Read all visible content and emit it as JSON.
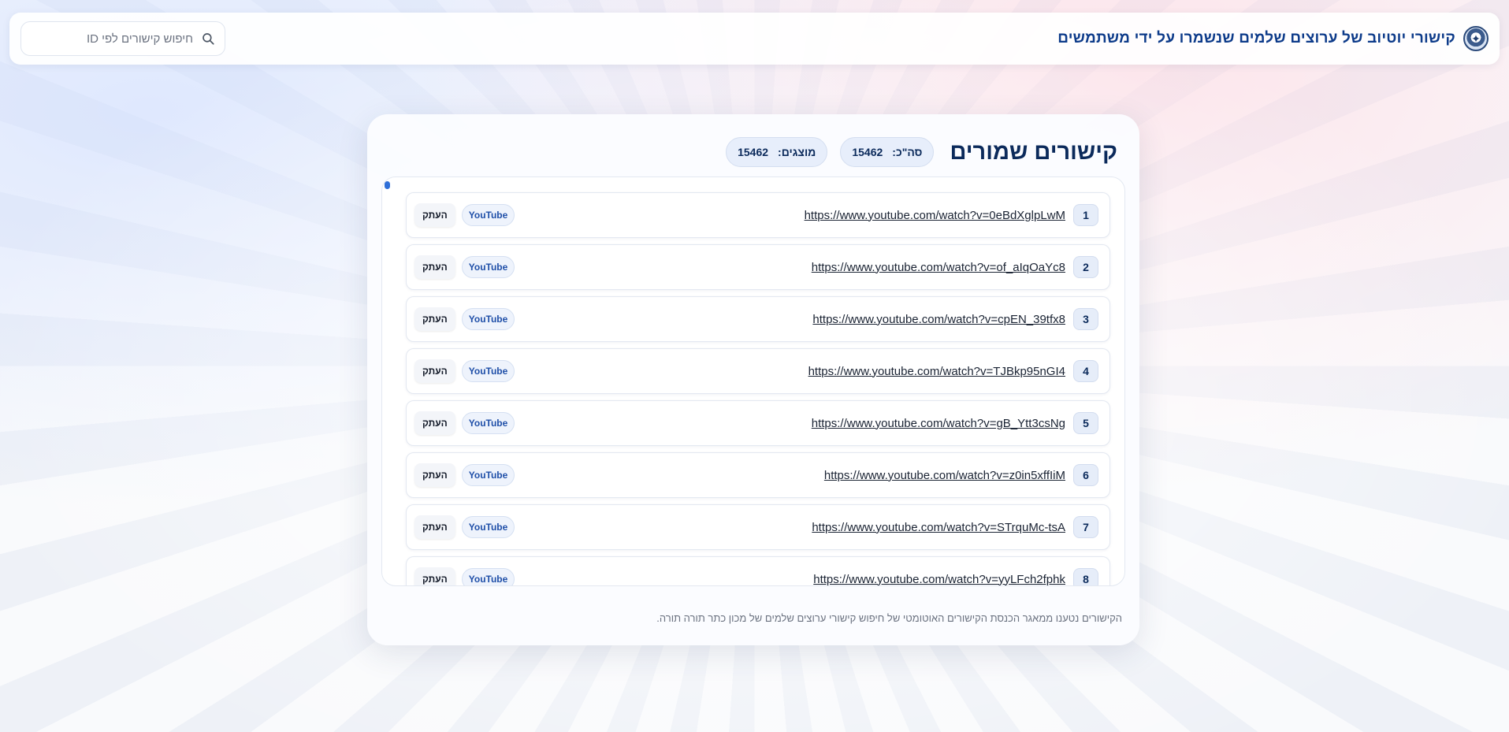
{
  "header": {
    "site_title": "קישורי יוטיוב של ערוצים שלמים שנשמרו על ידי משתמשים",
    "search_placeholder": "חיפוש קישורים לפי ID",
    "logo_icon": "emblem-icon"
  },
  "card": {
    "title": "קישורים שמורים",
    "total_label": "סה\"כ:",
    "total_value": "15462",
    "shown_label": "מוצגים:",
    "shown_value": "15462"
  },
  "rows": [
    {
      "num": "1",
      "url": "https://www.youtube.com/watch?v=0eBdXglpLwM",
      "tag": "YouTube",
      "copy": "העתק"
    },
    {
      "num": "2",
      "url": "https://www.youtube.com/watch?v=of_aIqOaYc8",
      "tag": "YouTube",
      "copy": "העתק"
    },
    {
      "num": "3",
      "url": "https://www.youtube.com/watch?v=cpEN_39tfx8",
      "tag": "YouTube",
      "copy": "העתק"
    },
    {
      "num": "4",
      "url": "https://www.youtube.com/watch?v=TJBkp95nGI4",
      "tag": "YouTube",
      "copy": "העתק"
    },
    {
      "num": "5",
      "url": "https://www.youtube.com/watch?v=gB_Ytt3csNg",
      "tag": "YouTube",
      "copy": "העתק"
    },
    {
      "num": "6",
      "url": "https://www.youtube.com/watch?v=z0in5xffIiM",
      "tag": "YouTube",
      "copy": "העתק"
    },
    {
      "num": "7",
      "url": "https://www.youtube.com/watch?v=STrquMc-tsA",
      "tag": "YouTube",
      "copy": "העתק"
    },
    {
      "num": "8",
      "url": "https://www.youtube.com/watch?v=yyLFch2fphk",
      "tag": "YouTube",
      "copy": "העתק"
    }
  ],
  "footer": {
    "note": "הקישורים נטענו ממאגר הכנסת הקישורים האוטומטי של חיפוש קישורי ערוצים שלמים של מכון כתר תורה תורה."
  },
  "colors": {
    "accent": "#0d3b8a",
    "pill_bg": "#e7eefb",
    "tag_text": "#1f4fa8"
  }
}
